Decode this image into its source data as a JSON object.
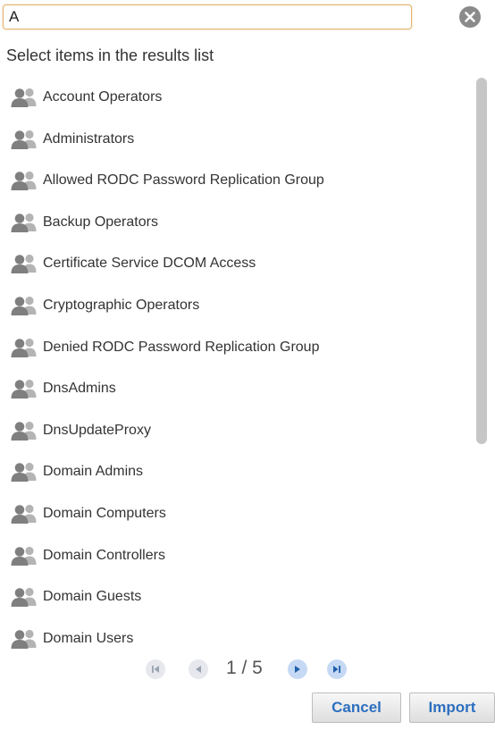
{
  "search": {
    "value": "A",
    "clear_icon": "close-circle-icon"
  },
  "instruction": "Select items in the results list",
  "results": [
    {
      "label": "Account Operators",
      "icon": "group-icon"
    },
    {
      "label": "Administrators",
      "icon": "group-icon"
    },
    {
      "label": "Allowed RODC Password Replication Group",
      "icon": "group-icon"
    },
    {
      "label": "Backup Operators",
      "icon": "group-icon"
    },
    {
      "label": "Certificate Service DCOM Access",
      "icon": "group-icon"
    },
    {
      "label": "Cryptographic Operators",
      "icon": "group-icon"
    },
    {
      "label": "Denied RODC Password Replication Group",
      "icon": "group-icon"
    },
    {
      "label": "DnsAdmins",
      "icon": "group-icon"
    },
    {
      "label": "DnsUpdateProxy",
      "icon": "group-icon"
    },
    {
      "label": "Domain Admins",
      "icon": "group-icon"
    },
    {
      "label": "Domain Computers",
      "icon": "group-icon"
    },
    {
      "label": "Domain Controllers",
      "icon": "group-icon"
    },
    {
      "label": "Domain Guests",
      "icon": "group-icon"
    },
    {
      "label": "Domain Users",
      "icon": "group-icon"
    }
  ],
  "pagination": {
    "text": "1 / 5",
    "current": 1,
    "total": 5
  },
  "buttons": {
    "cancel": "Cancel",
    "import": "Import"
  },
  "colors": {
    "accent": "#2d6fbf",
    "input_focus": "#e2b46f",
    "icon_gray": "#8f8f8f"
  }
}
